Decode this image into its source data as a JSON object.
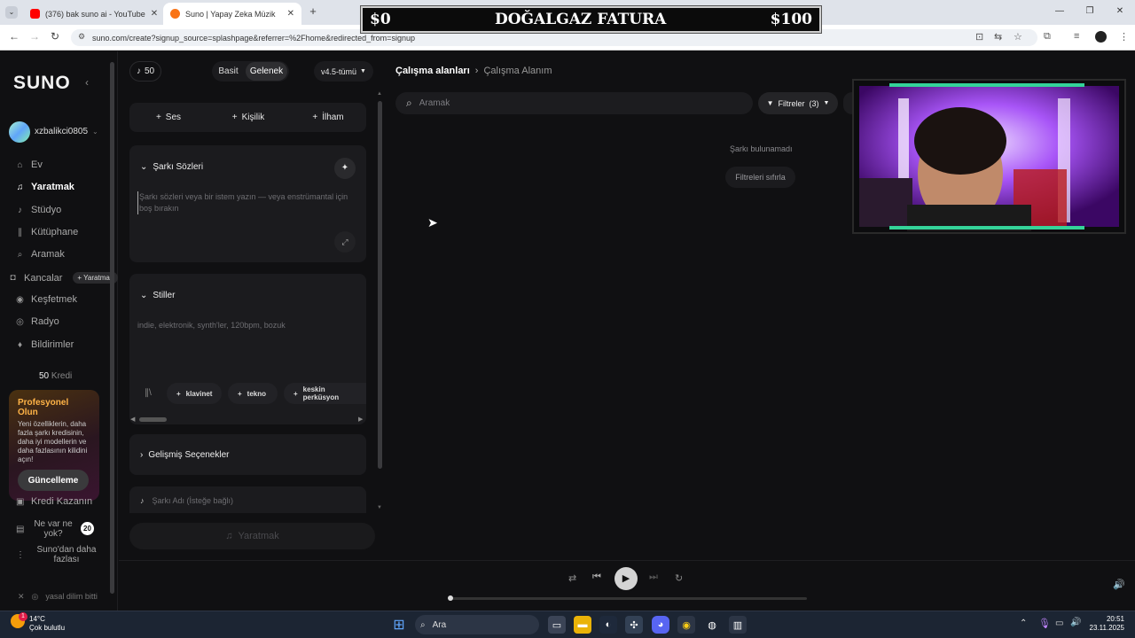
{
  "browser": {
    "tabs": [
      {
        "title": "(376) bak suno ai - YouTube",
        "active": false,
        "favicon_color": "#ff0000"
      },
      {
        "title": "Suno | Yapay Zeka Müzik",
        "active": true,
        "favicon_color": "#f97316"
      }
    ],
    "new_tab": "+",
    "url": "suno.com/create?signup_source=splashpage&referrer=%2Fhome&redirected_from=signup"
  },
  "stream_overlay": {
    "left": "$0",
    "title": "DOĞALGAZ FATURA",
    "right": "$100"
  },
  "sidebar": {
    "logo": "SUNO",
    "username": "xzbalikci0805",
    "nav": [
      {
        "label": "Ev",
        "icon": "home-icon"
      },
      {
        "label": "Yaratmak",
        "icon": "music-note-icon",
        "active": true
      },
      {
        "label": "Stüdyo",
        "icon": "studio-icon"
      },
      {
        "label": "Kütüphane",
        "icon": "library-icon"
      },
      {
        "label": "Aramak",
        "icon": "search-icon"
      },
      {
        "label": "Kancalar",
        "icon": "hook-icon",
        "badge": "+ Yaratmak"
      },
      {
        "label": "Keşfetmek",
        "icon": "compass-icon"
      },
      {
        "label": "Radyo",
        "icon": "radio-icon"
      },
      {
        "label": "Bildirimler",
        "icon": "bell-icon"
      }
    ],
    "credits_value": "50",
    "credits_label": "Kredi",
    "promo": {
      "title": "Profesyonel Olun",
      "description": "Yeni özelliklerin, daha fazla şarkı kredisinin, daha iyi modellerin ve daha fazlasının kilidini açın!",
      "button": "Güncelleme"
    },
    "earn_credits": "Kredi Kazanın",
    "whats_new": "Ne var ne yok?",
    "whats_new_count": "20",
    "more_from_suno": "Suno'dan daha fazlası",
    "footer_text": "yasal dilim bitti"
  },
  "create": {
    "credits": "50",
    "mode_simple": "Basit",
    "mode_custom": "Gelenek",
    "model": "v4.5-tümü",
    "add_buttons": [
      "Ses",
      "Kişilik",
      "İlham"
    ],
    "lyrics_title": "Şarkı Sözleri",
    "lyrics_placeholder": "Şarkı sözleri veya bir istem yazın — veya enstrümantal için boş bırakın",
    "styles_title": "Stiller",
    "styles_placeholder": "indie, elektronik, synth'ler, 120bpm, bozuk",
    "style_tags": [
      "klavinet",
      "tekno",
      "keskin perküsyon"
    ],
    "advanced_title": "Gelişmiş Seçenekler",
    "song_title_placeholder": "Şarkı Adı (İsteğe bağlı)",
    "create_button": "Yaratmak"
  },
  "workspace": {
    "breadcrumb_root": "Çalışma alanları",
    "breadcrumb_current": "Çalışma Alanım",
    "search_placeholder": "Aramak",
    "filters_label": "Filtreler",
    "filters_count": "(3)",
    "empty_text": "Şarkı bulunamadı",
    "reset_button": "Filtreleri sıfırla"
  },
  "player": {
    "progress": 0
  },
  "taskbar": {
    "weather_temp": "14°C",
    "weather_desc": "Çok bulutlu",
    "search_placeholder": "Ara",
    "notification_count": "1",
    "time": "20:51",
    "date": "23.11.2025"
  },
  "colors": {
    "accent_orange": "#ffb347",
    "bg": "#101012",
    "card": "#1b1b1e"
  }
}
